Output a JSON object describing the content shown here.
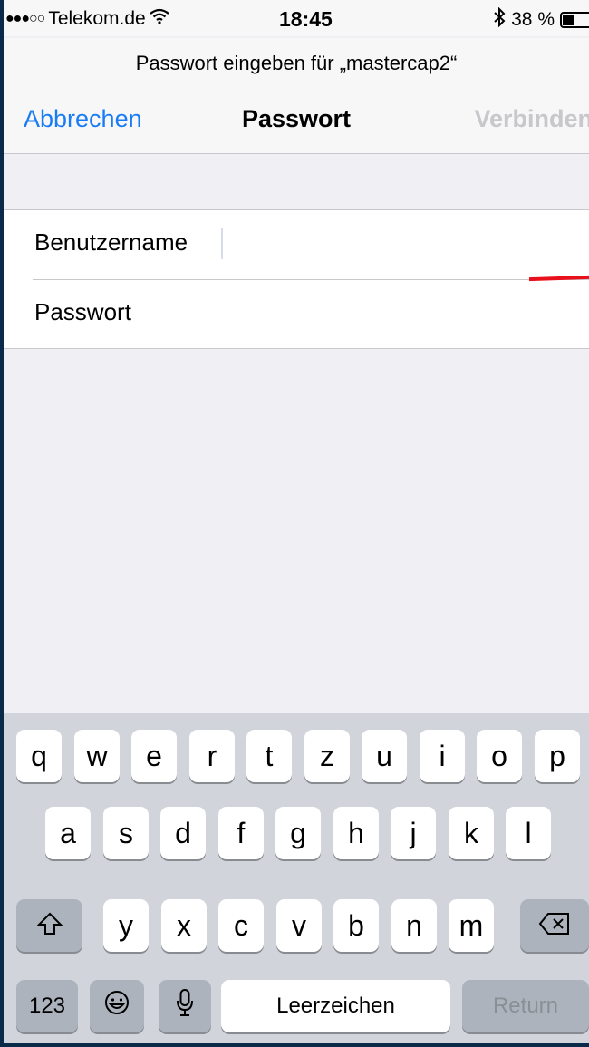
{
  "status_bar": {
    "signal": "●●●○○",
    "carrier": "Telekom.de",
    "wifi_icon": "wifi-icon",
    "time": "18:45",
    "bluetooth_icon": "bluetooth-icon",
    "battery_text": "38 %",
    "battery_level": 0.38
  },
  "prompt": "Passwort eingeben für „mastercap2“",
  "nav": {
    "cancel_label": "Abbrechen",
    "title": "Passwort",
    "connect_label": "Verbinden"
  },
  "form": {
    "username_label": "Benutzername",
    "username_value": "",
    "password_label": "Passwort",
    "password_value": ""
  },
  "keyboard": {
    "row1": [
      "q",
      "w",
      "e",
      "r",
      "t",
      "z",
      "u",
      "i",
      "o",
      "p"
    ],
    "row2": [
      "a",
      "s",
      "d",
      "f",
      "g",
      "h",
      "j",
      "k",
      "l"
    ],
    "row3": [
      "y",
      "x",
      "c",
      "v",
      "b",
      "n",
      "m"
    ],
    "shift_icon": "shift-icon",
    "delete_icon": "delete-icon",
    "numbers_label": "123",
    "emoji_icon": "emoji-icon",
    "mic_icon": "microphone-icon",
    "space_label": "Leerzeichen",
    "return_label": "Return"
  }
}
